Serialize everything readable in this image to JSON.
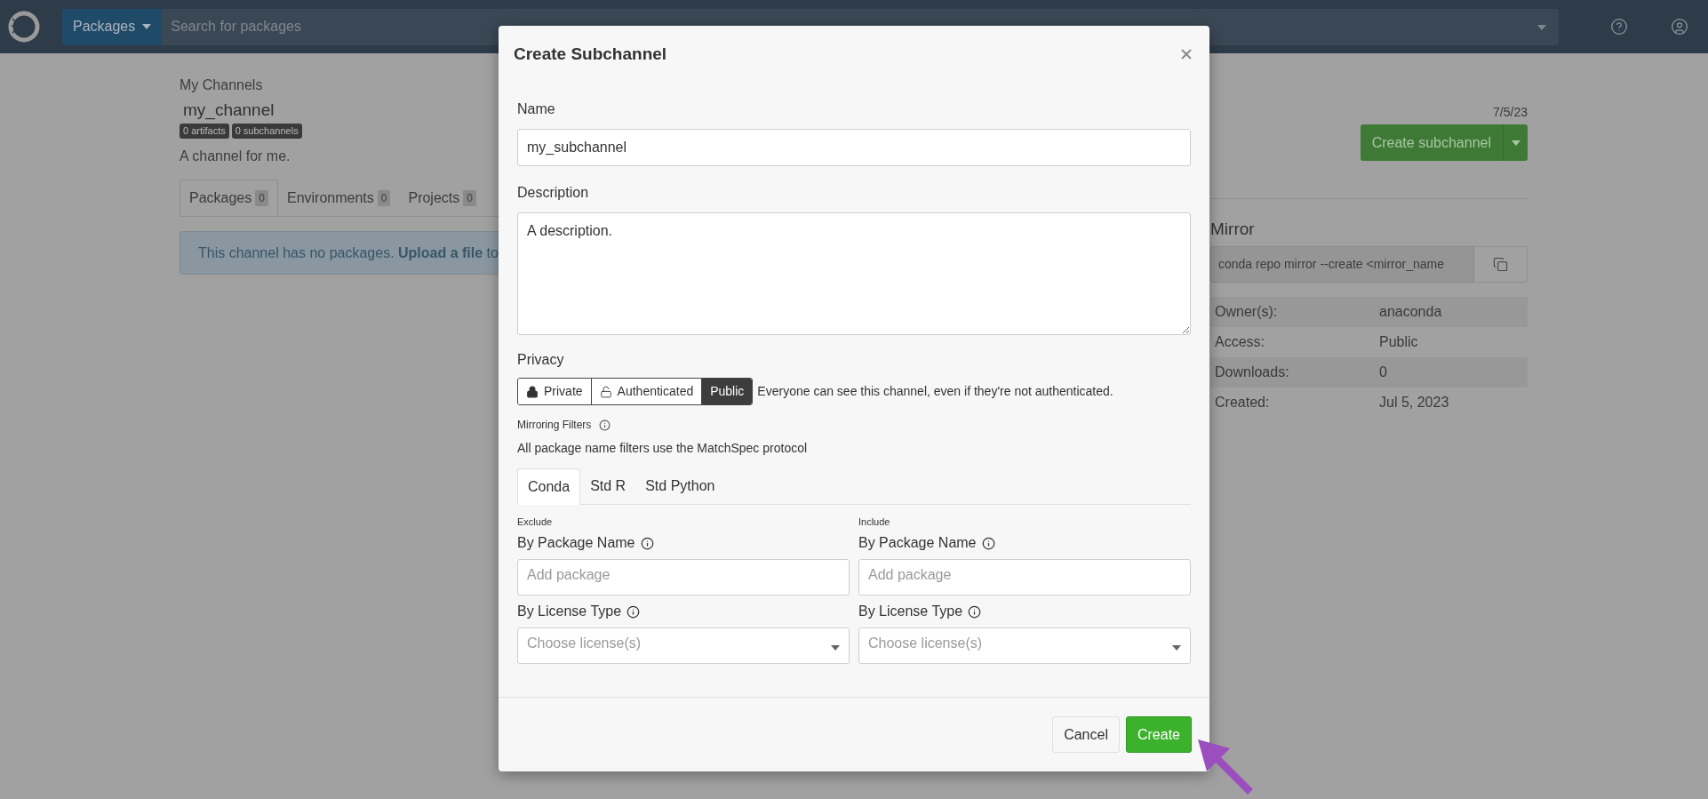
{
  "header": {
    "menu_button": "Packages",
    "search_placeholder": "Search for packages"
  },
  "channel": {
    "breadcrumb": "My Channels",
    "name": "my_channel",
    "badges": [
      "0 artifacts",
      "0 subchannels"
    ],
    "description": "A channel for me.",
    "date": "7/5/23",
    "create_button": "Create subchannel",
    "tabs": [
      {
        "label": "Packages",
        "count": "0",
        "selected": true
      },
      {
        "label": "Environments",
        "count": "0",
        "selected": false
      },
      {
        "label": "Projects",
        "count": "0",
        "selected": false
      }
    ],
    "alert": "This channel has no packages. **Upload a file** to"
  },
  "mirror": {
    "title": "Mirror",
    "command": "conda repo mirror --create <mirror_name",
    "details": [
      {
        "label": "Owner(s):",
        "value": "anaconda"
      },
      {
        "label": "Access:",
        "value": "Public"
      },
      {
        "label": "Downloads:",
        "value": "0"
      },
      {
        "label": "Created:",
        "value": "Jul 5, 2023"
      }
    ]
  },
  "modal": {
    "title": "Create Subchannel",
    "name": {
      "label": "Name",
      "value": "my_subchannel"
    },
    "description": {
      "label": "Description",
      "value": "A description."
    },
    "privacy": {
      "label": "Privacy",
      "options": [
        {
          "label": "Private",
          "kind": "locked",
          "selected": false
        },
        {
          "label": "Authenticated",
          "kind": "unlocked",
          "selected": false
        },
        {
          "label": "Public",
          "kind": "plain",
          "selected": true
        }
      ],
      "note": "Everyone can see this channel, even if they're not authenticated."
    },
    "filters_label": "Mirroring Filters",
    "filters_note": "All package name filters use the MatchSpec protocol",
    "tabs": [
      {
        "label": "Conda",
        "selected": true
      },
      {
        "label": "Std R",
        "selected": false
      },
      {
        "label": "Std Python",
        "selected": false
      }
    ],
    "columns": [
      {
        "heading": "Exclude",
        "package_label": "By Package Name",
        "package_placeholder": "Add package",
        "license_label": "By License Type",
        "license_placeholder": "Choose license(s)"
      },
      {
        "heading": "Include",
        "package_label": "By Package Name",
        "package_placeholder": "Add package",
        "license_label": "By License Type",
        "license_placeholder": "Choose license(s)"
      }
    ],
    "buttons": [
      {
        "label": "Cancel",
        "kind": "secondary"
      },
      {
        "label": "Create",
        "kind": "primary"
      }
    ]
  }
}
